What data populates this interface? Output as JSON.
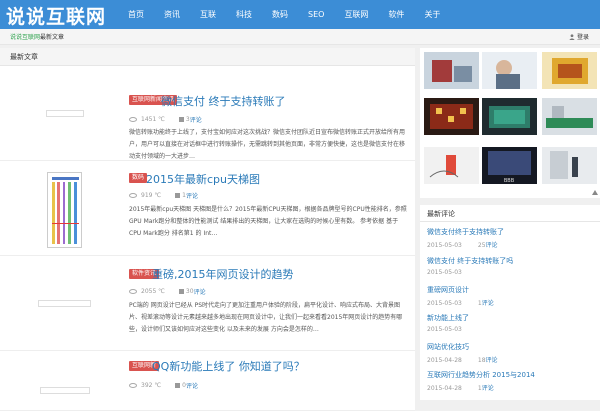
{
  "header": {
    "logo": "说说互联网",
    "nav": [
      "首页",
      "资讯",
      "互联",
      "科技",
      "数码",
      "SEO",
      "互联网",
      "软件",
      "关于"
    ]
  },
  "subbar": {
    "crumb_green": "说说互联网",
    "crumb_rest": "最新文章",
    "login": "登录"
  },
  "main": {
    "heading": "最新文章",
    "articles": [
      {
        "category": "互联网新闻资讯",
        "title": "微信支付 终于支持转账了",
        "views": "1451 ℃",
        "comments": "3",
        "comments_unit": "评论",
        "desc": "微信转账功能终于上线了，支付宝如何应对这次挑战？微信支付团队近日宣布微信转账正式开放给所有用户，用户可以直接在对话框中进行转账操作，无需跳转到其他页面，非常方便快捷，这也是微信支付在移动支付领域的一大进步…"
      },
      {
        "category": "数码",
        "title": "2015年最新cpu天梯图",
        "views": "919 ℃",
        "comments": "1",
        "comments_unit": "评论",
        "desc": "2015年最新cpu天梯图 天梯图是什么？2015年最新CPU天梯图，根据各品牌型号的CPU性能排名，参照GPU Mark跑分和整体的性能测试 结果排出的天梯图，让大家在选购的时候心里有数。 参考依据 基于 CPU Mark跑分 排名第1 的 Int…"
      },
      {
        "category": "软件资讯",
        "title": "重磅,2015年网页设计的趋势",
        "views": "2055 ℃",
        "comments": "30",
        "comments_unit": "评论",
        "desc": "PC端的 网页设计已经从 PS时代走向了更加注重用户体验的阶段，扁平化设计、响应式布局、大背景图片、视差滚动等设计元素越来越多地出现在网页设计中，让我们一起来看看2015年网页设计的趋势有哪些，设计师们又该如何应对这些变化 以及未来的发展 方向会是怎样的…"
      },
      {
        "category": "互联网新",
        "title": "QQ新功能上线了 你知道了吗？",
        "views": "392 ℃",
        "comments": "0",
        "comments_unit": "评论"
      }
    ]
  },
  "gallery": {
    "caption": "BBB",
    "colors": {
      "accent": "#3c8dd6",
      "tag": "#d9534f",
      "link": "#2a7ab8"
    }
  },
  "recent": {
    "heading": "最新评论",
    "items": [
      {
        "title": "微信支付终于支持转账了",
        "date": "2015-05-03",
        "count": "25",
        "unit": "评论"
      },
      {
        "title": "微信支付 终于支持转账了吗",
        "date": "2015-05-03",
        "count": "",
        "unit": ""
      },
      {
        "title": "重磅网页设计",
        "date": "2015-05-03",
        "count": "1",
        "unit": "评论"
      },
      {
        "title": "新功能上线了",
        "date": "2015-05-03",
        "count": "",
        "unit": ""
      },
      {
        "title": "网站优化技巧",
        "date": "2015-04-28",
        "count": "18",
        "unit": "评论"
      },
      {
        "title": "互联网行业趋势分析 2015与2014",
        "date": "2015-04-28",
        "count": "1",
        "unit": "评论"
      }
    ]
  }
}
